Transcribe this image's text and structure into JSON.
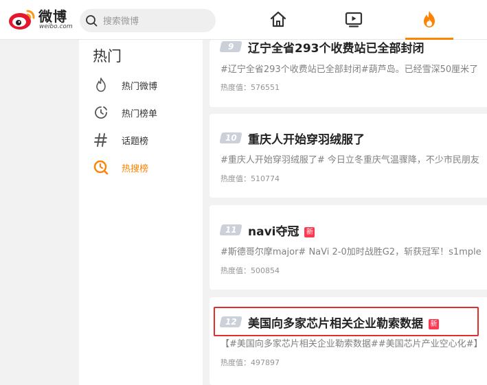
{
  "header": {
    "logo_text": "微博",
    "logo_sub": "weibo.com",
    "search_placeholder": "搜索微博",
    "nav": [
      "home-icon",
      "video-icon",
      "hot-fire-icon"
    ]
  },
  "sidebar": {
    "title": "热门",
    "items": [
      {
        "label": "热门微博",
        "icon": "flame-outline-icon",
        "active": false
      },
      {
        "label": "热门榜单",
        "icon": "clock-chart-icon",
        "active": false
      },
      {
        "label": "话题榜",
        "icon": "hash-icon",
        "active": false
      },
      {
        "label": "热搜榜",
        "icon": "hot-search-icon",
        "active": true
      }
    ]
  },
  "feed": [
    {
      "rank": "9",
      "title": "辽宁全省293个收费站已全部封闭",
      "new": false,
      "new_label": "",
      "desc": "#辽宁全省293个收费站已全部封闭#葫芦岛。已经雪深50厘米了",
      "heat": "热度值：576551"
    },
    {
      "rank": "10",
      "title": "重庆人开始穿羽绒服了",
      "new": false,
      "new_label": "",
      "desc": "#重庆人开始穿羽绒服了# 今日立冬重庆气温骤降，不少市民朋友",
      "heat": "热度值：510774"
    },
    {
      "rank": "11",
      "title": "navi夺冠",
      "new": true,
      "new_label": "新",
      "desc": "#斯德哥尔摩major# NaVi 2-0加时战胜G2，斩获冠军！s1mple",
      "heat": "热度值：500854"
    },
    {
      "rank": "12",
      "title": "美国向多家芯片相关企业勒索数据",
      "new": true,
      "new_label": "新",
      "desc": "【#美国向多家芯片相关企业勒索数据##美国芯片产业空心化#】",
      "heat": "热度值：497897"
    }
  ],
  "colors": {
    "accent": "#ff8200",
    "new_badge": "#ff3852",
    "highlight": "#e32c2c"
  }
}
